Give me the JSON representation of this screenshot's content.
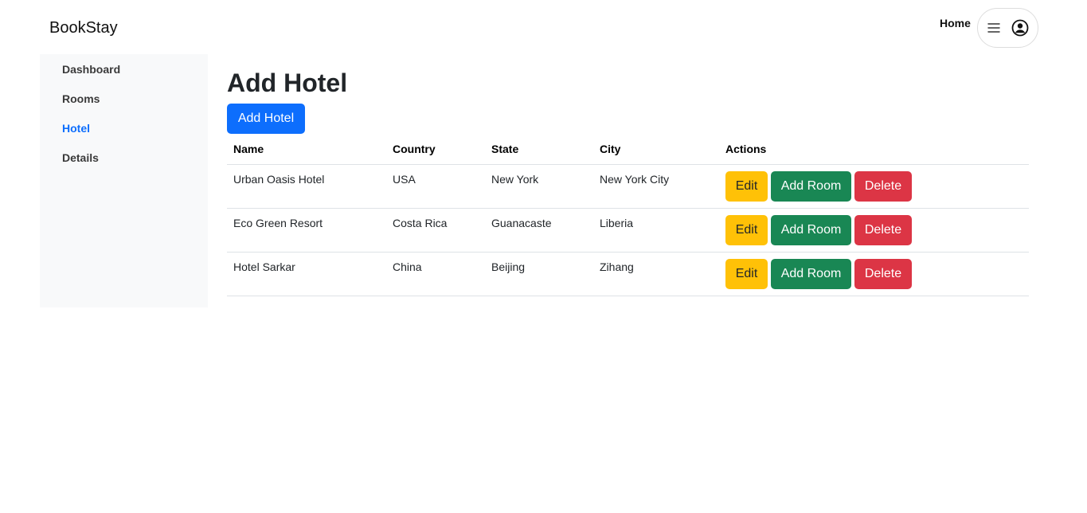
{
  "header": {
    "brand": "BookStay",
    "home_link": "Home",
    "menu_icon": "hamburger-icon",
    "user_icon": "user-circle-icon"
  },
  "sidebar": {
    "items": [
      {
        "label": "Dashboard",
        "active": false
      },
      {
        "label": "Rooms",
        "active": false
      },
      {
        "label": "Hotel",
        "active": true
      },
      {
        "label": "Details",
        "active": false
      }
    ]
  },
  "main": {
    "title": "Add Hotel",
    "add_button": "Add Hotel",
    "table": {
      "headers": [
        "Name",
        "Country",
        "State",
        "City",
        "Actions"
      ],
      "rows": [
        {
          "name": "Urban Oasis Hotel",
          "country": "USA",
          "state": "New York",
          "city": "New York City"
        },
        {
          "name": "Eco Green Resort",
          "country": "Costa Rica",
          "state": "Guanacaste",
          "city": "Liberia"
        },
        {
          "name": "Hotel Sarkar",
          "country": "China",
          "state": "Beijing",
          "city": "Zihang"
        }
      ],
      "actions": {
        "edit": "Edit",
        "add_room": "Add Room",
        "delete": "Delete"
      }
    }
  },
  "colors": {
    "primary": "#0d6efd",
    "warning": "#ffc107",
    "success": "#198754",
    "danger": "#dc3545",
    "sidebar_bg": "#f8f9fa"
  }
}
